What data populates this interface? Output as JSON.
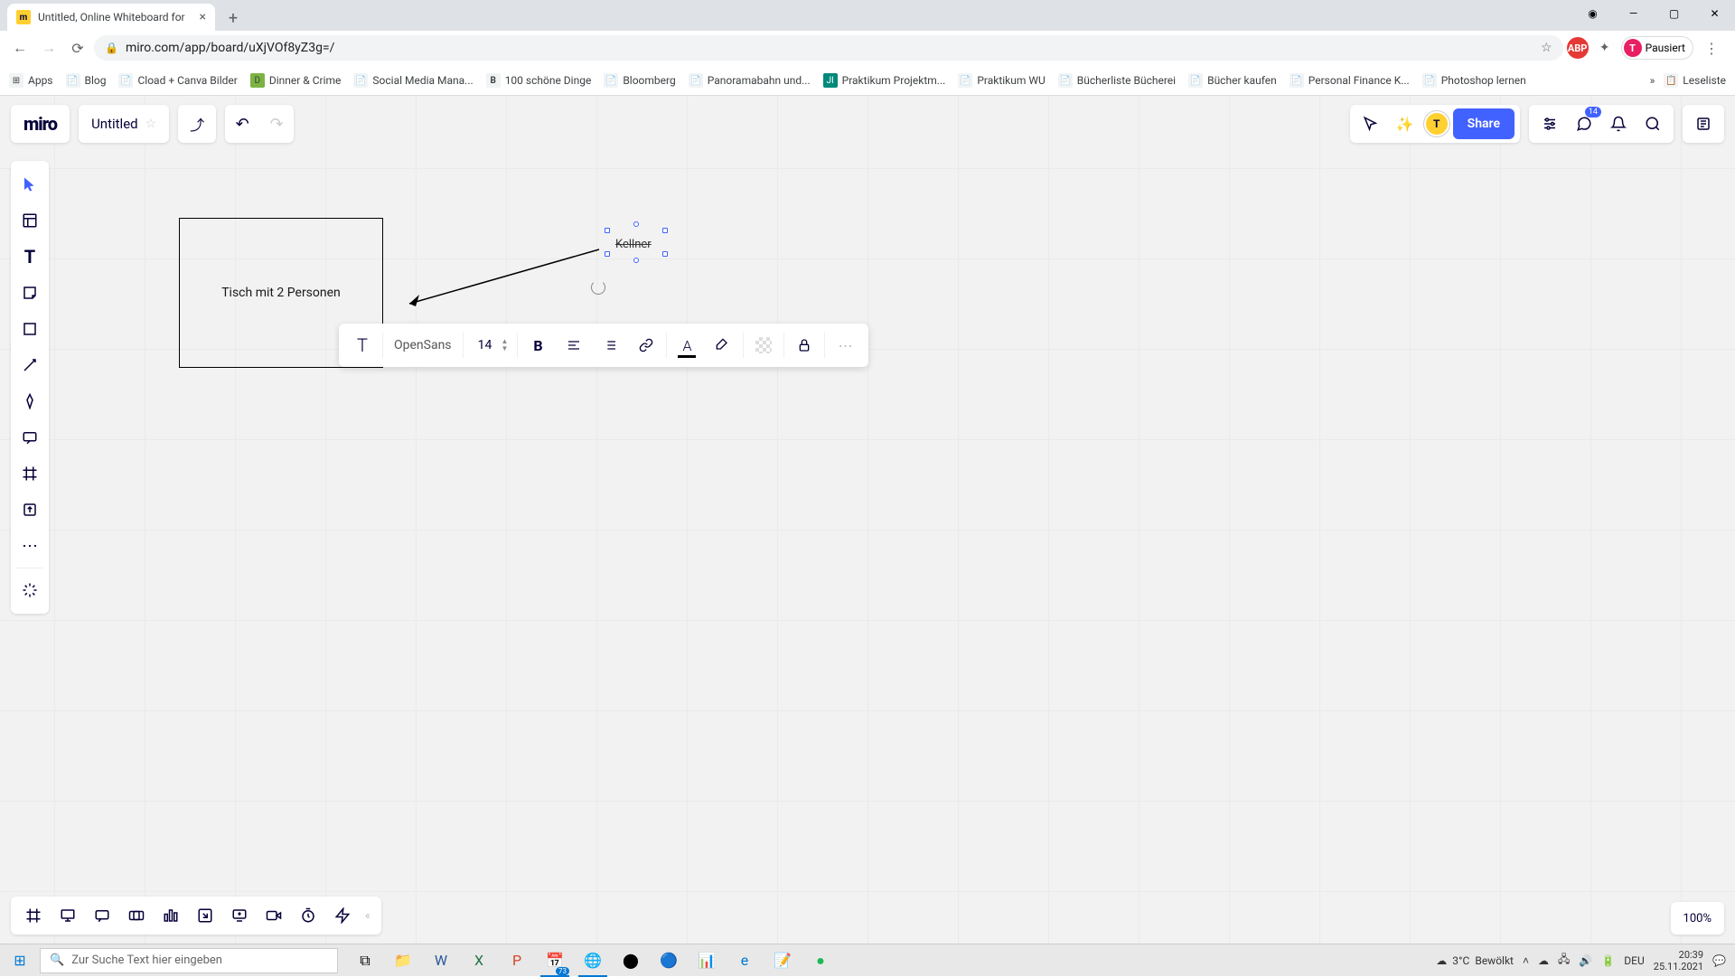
{
  "browser": {
    "tab_title": "Untitled, Online Whiteboard for",
    "url": "miro.com/app/board/uXjVOf8yZ3g=/",
    "profile_label": "Pausiert",
    "profile_initial": "T",
    "bookmarks": [
      "Apps",
      "Blog",
      "Cload + Canva Bilder",
      "Dinner & Crime",
      "Social Media Mana...",
      "100 schöne Dinge",
      "Bloomberg",
      "Panoramabahn und...",
      "Praktikum Projektm...",
      "Praktikum WU",
      "Bücherliste Bücherei",
      "Bücher kaufen",
      "Personal Finance K...",
      "Photoshop lernen"
    ],
    "bookmark_right": "Leseliste"
  },
  "miro": {
    "logo": "miro",
    "board_title": "Untitled",
    "share_label": "Share",
    "notification_count": "14",
    "zoom": "100%",
    "font_name": "OpenSans",
    "font_size": "14"
  },
  "canvas": {
    "rect_text": "Tisch mit 2 Personen",
    "text_label": "Kellner"
  },
  "taskbar": {
    "search_placeholder": "Zur Suche Text hier eingeben",
    "weather_temp": "3°C",
    "weather_cond": "Bewölkt",
    "lang": "DEU",
    "time": "20:39",
    "date": "25.11.2021",
    "calendar_badge": "73"
  }
}
